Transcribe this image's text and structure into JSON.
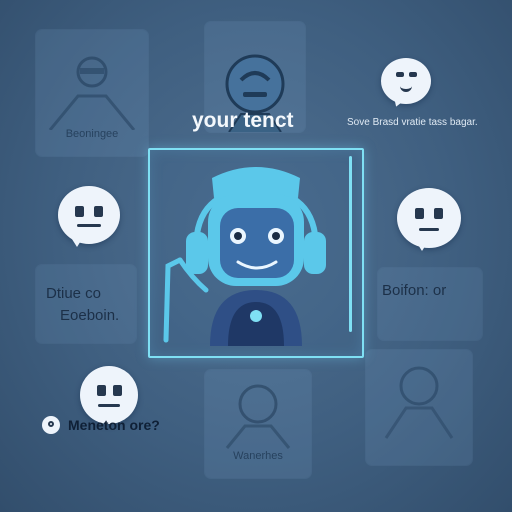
{
  "header": {
    "title": "your tenct",
    "subtitle": "Sove Brasd vratie tass bagar."
  },
  "cards": {
    "top_left": {
      "caption": "Beoningee"
    },
    "bottom_center": {
      "caption": "Wanerhes"
    }
  },
  "labels": {
    "left_top": "Dtiue  co",
    "left_bottom": "Eoeboin.",
    "right": "Boifon:  or",
    "bottom_left": "Meneton  ore?"
  },
  "colors": {
    "accent": "#7fe0f4",
    "robot_body": "#5bc8ea",
    "robot_face": "#3b6ea8",
    "background": "#3f5f80"
  },
  "icons": [
    "robot-avatar",
    "chat-bubble-face",
    "user-avatar",
    "comment-bubble"
  ]
}
